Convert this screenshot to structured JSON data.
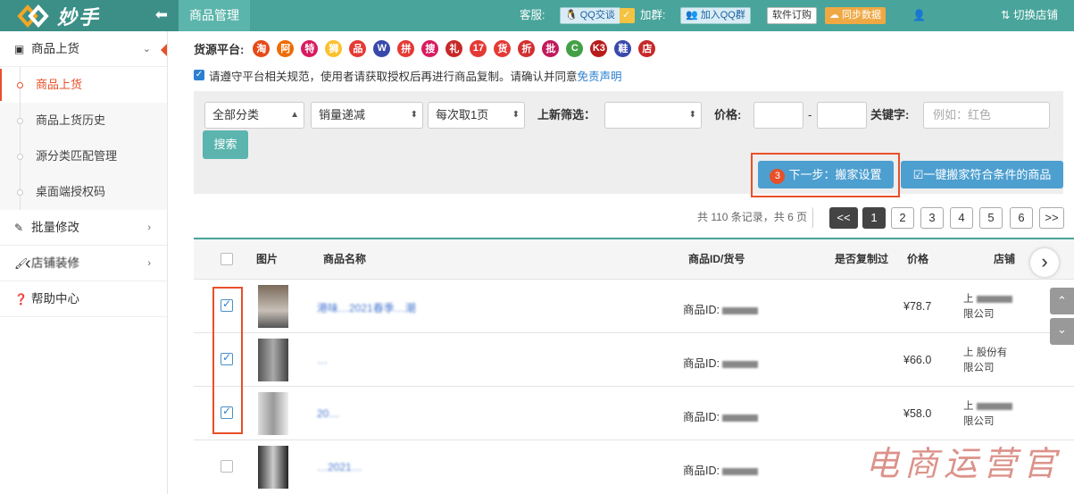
{
  "app": {
    "name": "妙手"
  },
  "topbar": {
    "active_tab": "商品管理",
    "service_label": "客服:",
    "qq_chat": "QQ交谈",
    "group_label": "加群:",
    "join_qq": "加入QQ群",
    "software_order": "软件订购",
    "sync_data": "同步数据",
    "user_name": "",
    "switch_store": "切换店铺"
  },
  "sidebar": {
    "items": [
      {
        "label": "商品上货",
        "icon": "box-icon"
      },
      {
        "label": "商品上货"
      },
      {
        "label": "商品上货历史"
      },
      {
        "label": "源分类匹配管理"
      },
      {
        "label": "桌面端授权码"
      },
      {
        "label": "批量修改",
        "icon": "edit-icon"
      },
      {
        "label": "店铺装修",
        "icon": "brush-icon"
      },
      {
        "label": "帮助中心",
        "icon": "help-icon"
      }
    ]
  },
  "source_platform": {
    "label": "货源平台:",
    "platforms": [
      {
        "glyph": "淘",
        "color": "#e64a19"
      },
      {
        "glyph": "阿",
        "color": "#ef6c00"
      },
      {
        "glyph": "特",
        "color": "#d81b60"
      },
      {
        "glyph": "狮",
        "color": "#fbc02d"
      },
      {
        "glyph": "品",
        "color": "#e53935"
      },
      {
        "glyph": "W",
        "color": "#3949ab"
      },
      {
        "glyph": "拼",
        "color": "#e53935"
      },
      {
        "glyph": "搜",
        "color": "#d81b60"
      },
      {
        "glyph": "礼",
        "color": "#c62828"
      },
      {
        "glyph": "17",
        "color": "#e53935"
      },
      {
        "glyph": "货",
        "color": "#e53935"
      },
      {
        "glyph": "折",
        "color": "#d32f2f"
      },
      {
        "glyph": "批",
        "color": "#c2185b"
      },
      {
        "glyph": "C",
        "color": "#43a047"
      },
      {
        "glyph": "K3",
        "color": "#b71c1c"
      },
      {
        "glyph": "鞋",
        "color": "#3949ab"
      },
      {
        "glyph": "店",
        "color": "#c62828"
      }
    ]
  },
  "notice": {
    "text": "请遵守平台相关规范，使用者请获取授权后再进行商品复制。请确认并同意",
    "link": "免责声明"
  },
  "filters": {
    "category": "全部分类",
    "sort": "销量递减",
    "per_fetch": "每次取1页",
    "new_filter_label": "上新筛选：",
    "new_filter_value": "",
    "price_label": "价格:",
    "price_sep": "-",
    "keyword_label": "关键字:",
    "keyword_placeholder": "例如：红色",
    "search_button": "搜索",
    "next_step_badge": "3",
    "next_step_button": "下一步：搬家设置",
    "one_click_button": "一键搬家符合条件的商品"
  },
  "pagination": {
    "summary": "共 110 条记录，共 6 页",
    "prev": "<<",
    "pages": [
      "1",
      "2",
      "3",
      "4",
      "5",
      "6"
    ],
    "next": ">>",
    "current": 1
  },
  "table": {
    "headers": [
      "图片",
      "商品名称",
      "商品ID/货号",
      "是否复制过",
      "价格",
      "店铺"
    ],
    "rows": [
      {
        "checked": true,
        "name": "港味…2021春季…潮",
        "id": "商品ID:",
        "price": "¥78.7",
        "store_line1": "上",
        "store_line2": "限公司"
      },
      {
        "checked": true,
        "name": "…",
        "id": "商品ID:",
        "price": "¥66.0",
        "store_line1": "上 股份有",
        "store_line2": "限公司"
      },
      {
        "checked": true,
        "name": "20…",
        "id": "商品ID:",
        "price": "¥58.0",
        "store_line1": "上",
        "store_line2": "限公司"
      },
      {
        "checked": false,
        "name": "…2021…",
        "id": "商品ID:",
        "price": "",
        "store_line1": "",
        "store_line2": ""
      }
    ]
  },
  "watermark": "电商运营官"
}
